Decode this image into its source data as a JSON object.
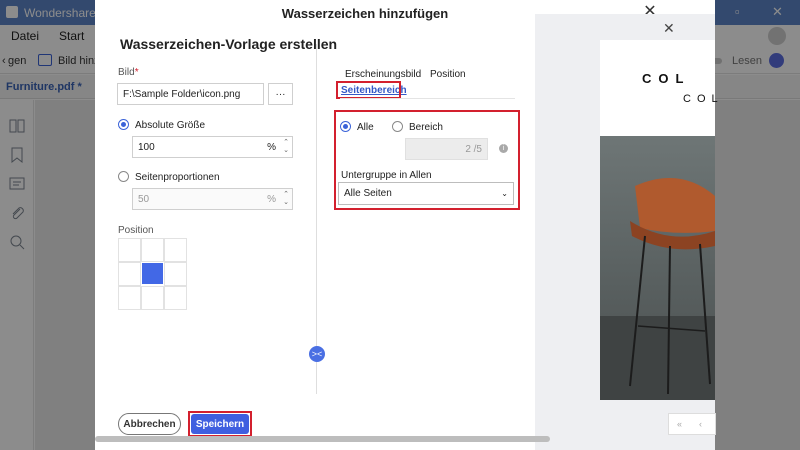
{
  "app": {
    "title": "Wondershare PDFelement",
    "window_controls": [
      "–",
      "▫",
      "✕"
    ]
  },
  "menu": {
    "items": [
      "Datei",
      "Start"
    ]
  },
  "toolbar": {
    "left_label": "gen",
    "add_image_label": "Bild hinzu",
    "read_label": "Lesen"
  },
  "doc_tab": {
    "label": "Furniture.pdf *"
  },
  "dialog": {
    "title": "Wasserzeichen hinzufügen",
    "close": "✕",
    "heading": "Wasserzeichen-Vorlage erstellen",
    "image_field": {
      "label": "Bild",
      "required_mark": "*",
      "value": "F:\\Sample Folder\\icon.png",
      "browse": "···"
    },
    "size": {
      "absolute_label": "Absolute Größe",
      "absolute_value": "100",
      "absolute_unit": "%",
      "absolute_selected": true,
      "proportion_label": "Seitenproportionen",
      "proportion_value": "50",
      "proportion_unit": "%"
    },
    "position": {
      "label": "Position",
      "selected_cell": 4
    },
    "tabs": [
      {
        "label": "Erscheinungsbild",
        "active": false
      },
      {
        "label": "Position",
        "active": false
      },
      {
        "label": "Seitenbereich",
        "active": true
      }
    ],
    "page_range": {
      "all_label": "Alle",
      "range_label": "Bereich",
      "range_value": "2 /5",
      "info_icon": "info-icon",
      "subset_label": "Untergruppe in Allen",
      "subset_value": "Alle Seiten"
    },
    "buttons": {
      "cancel": "Abbrechen",
      "save": "Speichern"
    },
    "collapse_label": "><"
  },
  "preview": {
    "line1": "COL",
    "line2": "COL"
  },
  "colors": {
    "accent": "#3f5fe0",
    "highlight_red": "#d3202e",
    "titlebar": "#5e86c8"
  }
}
